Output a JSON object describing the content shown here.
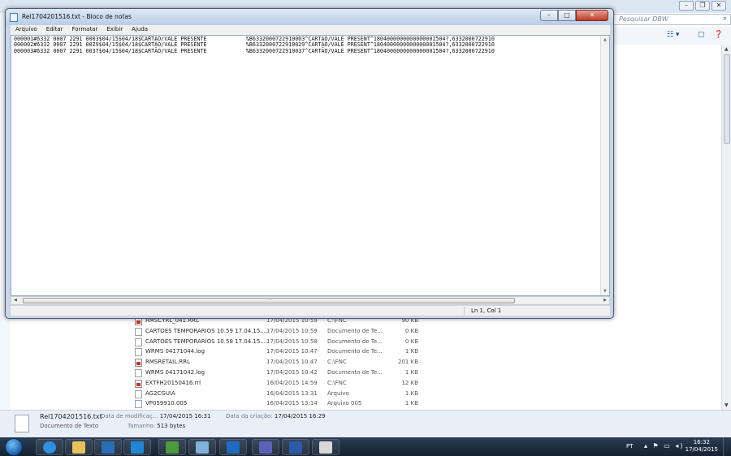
{
  "background_window": {
    "search_placeholder": "Pesquisar DBW",
    "search_icon": "magnifier-icon",
    "files": [
      {
        "name": "RMSCYRL_041.RRL",
        "date": "17/04/2015 10:59",
        "type": "C:\\FNC",
        "size": "90 KB",
        "icon": "red"
      },
      {
        "name": "CARTOES TEMPORARIOS 10.59 17.04.15....",
        "date": "17/04/2015 10:59",
        "type": "Documento de Te...",
        "size": "0 KB",
        "icon": "doc"
      },
      {
        "name": "CARTOES TEMPORARIOS 10.58 17.04.15....",
        "date": "17/04/2015 10:58",
        "type": "Documento de Te...",
        "size": "0 KB",
        "icon": "doc"
      },
      {
        "name": "WRMS 04171044.log",
        "date": "17/04/2015 10:47",
        "type": "Documento de Te...",
        "size": "1 KB",
        "icon": "doc"
      },
      {
        "name": "RMSRETAIL.RRL",
        "date": "17/04/2015 10:47",
        "type": "C:\\FNC",
        "size": "201 KB",
        "icon": "red"
      },
      {
        "name": "WRMS 04171042.log",
        "date": "17/04/2015 10:42",
        "type": "Documento de Te...",
        "size": "1 KB",
        "icon": "doc"
      },
      {
        "name": "EXTFH20150416.rrl",
        "date": "16/04/2015 14:59",
        "type": "C:\\FNC",
        "size": "12 KB",
        "icon": "red"
      },
      {
        "name": "AG2CGUIA",
        "date": "16/04/2015 13:31",
        "type": "Arquivo",
        "size": "1 KB",
        "icon": "doc"
      },
      {
        "name": "VP059910.005",
        "date": "16/04/2015 13:14",
        "type": "Arquivo 005",
        "size": "1 KB",
        "icon": "doc"
      }
    ],
    "details": {
      "file_name": "Rel1704201516.txt",
      "file_type": "Documento de Texto",
      "modified_label": "Data de modificaç...",
      "modified_value": "17/04/2015 16:31",
      "created_label": "Data da criação:",
      "created_value": "17/04/2015 16:29",
      "size_label": "Tamanho:",
      "size_value": "513 bytes"
    }
  },
  "notepad": {
    "title": "Rel1704201516.txt - Bloco de notas",
    "menu": [
      "Arquivo",
      "Editar",
      "Formatar",
      "Exibir",
      "Ajuda"
    ],
    "content": "000001#6332 0007 2291 0003$04/15$04/18$CARTÃO/VALE PRESENTE            %B6332000722910003^CARTÃO/VALE PRESENT^1804000000000000001504?,6332000722910\n000002#6332 0007 2291 0029$04/15$04/18$CARTÃO/VALE PRESENTE            %B6332000722910029^CARTÃO/VALE PRESENT^1804000000000000001504?,6332000722910\n000003#6332 0007 2291 0037$04/15$04/18$CARTÃO/VALE PRESENTE            %B6332000722910037^CARTÃO/VALE PRESENT^1804000000000000001504?,6332000722910",
    "status_position": "Ln 1, Col 1"
  },
  "taskbar": {
    "language": "PT",
    "time": "16:32",
    "date": "17/04/2015",
    "pinned_icons": [
      "ie-icon",
      "explorer-folder-icon",
      "outlook-icon",
      "lync-icon",
      "green-app-icon",
      "app-icon",
      "outlook-mail-icon",
      "network-icon",
      "word-icon",
      "paint-icon"
    ]
  },
  "colors": {
    "titlebar": "#c6d6ea",
    "close_button": "#c0392b",
    "taskbar": "#1f2d3d"
  }
}
